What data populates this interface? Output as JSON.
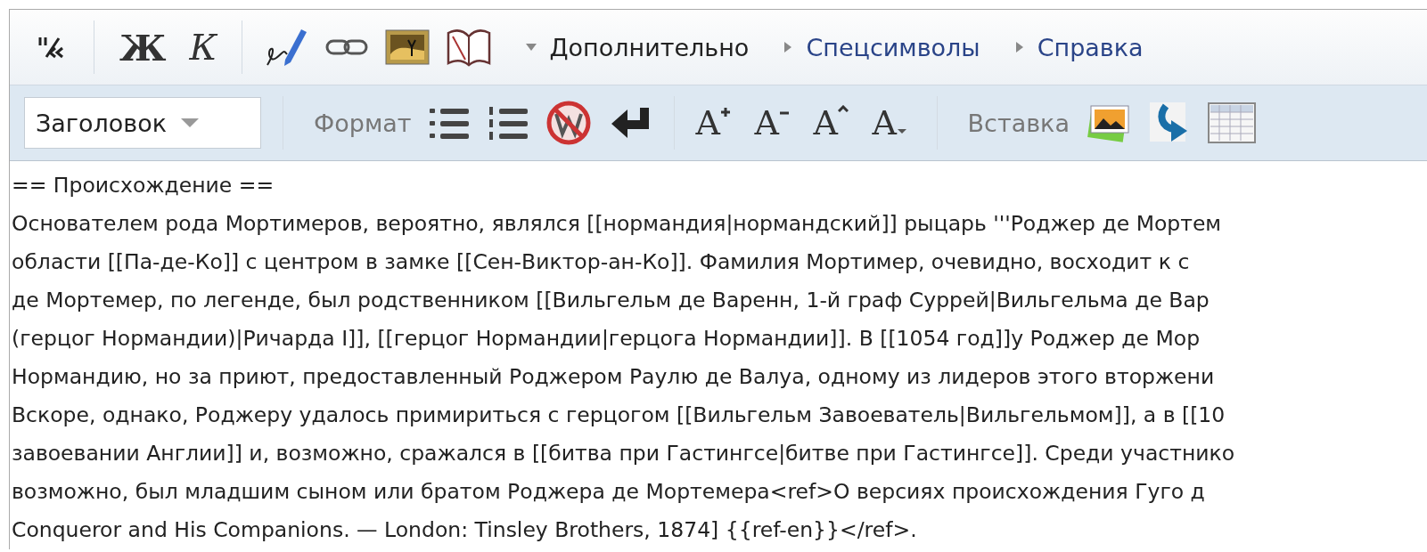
{
  "toolbar": {
    "main_buttons": [
      {
        "kind": "quote"
      },
      {
        "kind": "sep"
      },
      {
        "kind": "bold",
        "label": "Ж"
      },
      {
        "kind": "italic",
        "label": "К"
      },
      {
        "kind": "sep"
      },
      {
        "kind": "signature"
      },
      {
        "kind": "link"
      },
      {
        "kind": "image"
      },
      {
        "kind": "book"
      }
    ],
    "sections": [
      {
        "label": "Дополнительно",
        "expanded": true
      },
      {
        "label": "Спецсимволы",
        "expanded": false
      },
      {
        "label": "Справка",
        "expanded": false
      }
    ],
    "heading_select": {
      "value": "Заголовок"
    },
    "groups": [
      {
        "label": "Формат",
        "tools": [
          {
            "kind": "bullet-list"
          },
          {
            "kind": "numbered-list"
          },
          {
            "kind": "nowiki"
          },
          {
            "kind": "newline"
          }
        ]
      },
      {
        "tools": [
          {
            "kind": "big",
            "label": "A"
          },
          {
            "kind": "small",
            "label": "A"
          },
          {
            "kind": "sup",
            "label": "A"
          },
          {
            "kind": "sub",
            "label": "A"
          }
        ]
      },
      {
        "label": "Вставка",
        "tools": [
          {
            "kind": "gallery"
          },
          {
            "kind": "redirect"
          },
          {
            "kind": "table"
          }
        ]
      }
    ]
  },
  "editor": {
    "lines": [
      "== Происхождение ==",
      "Основателем рода Мортимеров, вероятно, являлся [[нормандия|нормандский]] рыцарь '''Роджер де Мортем",
      "области [[Па-де-Ко]] с центром в замке [[Сен-Виктор-ан-Ко]]. Фамилия Мортимер, очевидно, восходит к с",
      "де Мортемер, по легенде, был родственником [[Вильгельм де Варенн, 1-й граф Суррей|Вильгельма де Вар",
      "(герцог Нормандии)|Ричарда I]], [[герцог Нормандии|герцога Нормандии]]. В [[1054 год]]у Роджер де Мор",
      "Нормандию, но за приют, предоставленный Роджером Раулю де Валуа, одному из лидеров этого вторжени",
      "Вскоре, однако, Роджеру удалось примириться с герцогом [[Вильгельм Завоеватель|Вильгельмом]], а в [[10",
      "завоевании Англии]] и, возможно, сражался в [[битва при Гастингсе|битве при Гастингсе]]. Среди участнико",
      "возможно, был младшим сыном или братом Роджера де Мортемера<ref>О версиях происхождения Гуго д",
      "Conqueror and His Companions. — London: Tinsley Brothers, 1874] {{ref-en}}</ref>."
    ]
  }
}
